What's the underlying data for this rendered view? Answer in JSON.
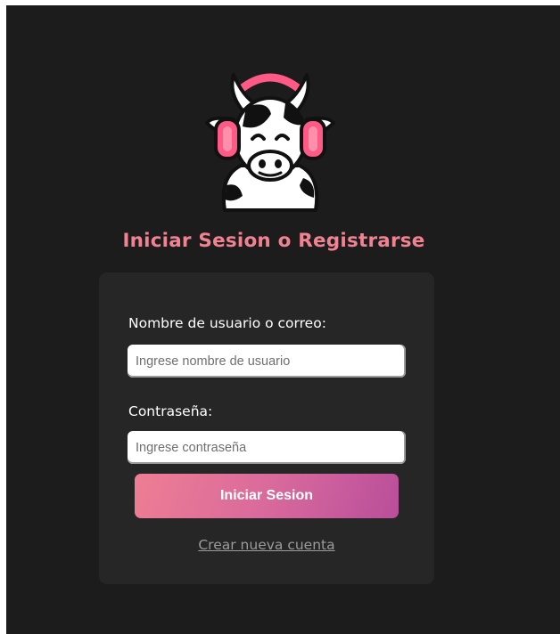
{
  "page": {
    "title": "Iniciar Sesion o Registrarse"
  },
  "logo": {
    "icon": "cow-headphones-icon"
  },
  "form": {
    "username_label": "Nombre de usuario o correo:",
    "username_placeholder": "Ingrese nombre de usuario",
    "username_value": "",
    "password_label": "Contraseña:",
    "password_placeholder": "Ingrese contraseña",
    "password_value": "",
    "submit_label": "Iniciar Sesion",
    "create_account_label": "Crear nueva cuenta"
  },
  "colors": {
    "background": "#1c1c1c",
    "card": "#262626",
    "accent": "#f08292",
    "button_gradient_start": "#ee7e93",
    "button_gradient_end": "#b94e9b",
    "link": "#9b9b9b"
  }
}
